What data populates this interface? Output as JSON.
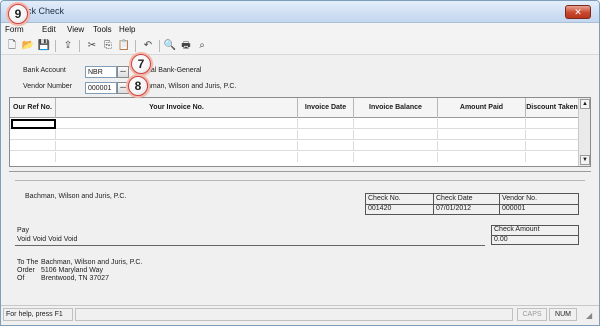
{
  "window": {
    "title": "Quick Check",
    "title_visible": "ick Check",
    "close_glyph": "✕"
  },
  "callouts": {
    "c9": "9",
    "c7": "7",
    "c8": "8"
  },
  "menu": {
    "items": [
      "Form",
      "Edit",
      "View",
      "Tools",
      "Help"
    ]
  },
  "toolbar": {
    "icons": [
      "new-document-icon",
      "open-folder-icon",
      "save-icon",
      "export-icon",
      "cut-icon",
      "copy-icon",
      "paste-icon",
      "undo-icon",
      "find-icon",
      "print-icon",
      "spellcheck-icon"
    ],
    "glyphs": [
      "🗋",
      "📂",
      "💾",
      "⇪",
      "✂",
      "⎘",
      "📋",
      "↶",
      "🔍",
      "🖶",
      "⌕"
    ]
  },
  "form": {
    "bank_account_label": "Bank Account",
    "bank_account_value": "NBR",
    "bank_account_desc": "nal Bank-General",
    "vendor_number_label": "Vendor Number",
    "vendor_number_value": "000001",
    "vendor_desc": "hman, Wilson and Juris, P.C.",
    "ellipsis": "..."
  },
  "grid": {
    "columns": [
      "Our Ref No.",
      "Your Invoice No.",
      "Invoice Date",
      "Invoice Balance",
      "Amount Paid",
      "Discount Taken"
    ],
    "scroll_up": "▲",
    "scroll_down": "▼"
  },
  "check": {
    "payee_name": "Bachman, Wilson and Juris, P.C.",
    "check_no_label": "Check No.",
    "check_no_value": "001420",
    "check_date_label": "Check Date",
    "check_date_value": "07/01/2012",
    "vendor_no_label": "Vendor No.",
    "vendor_no_value": "000001",
    "pay_label": "Pay",
    "pay_words": "Void Void Void Void",
    "check_amount_label": "Check Amount",
    "check_amount_value": "0.00",
    "to_the_label": "To The",
    "order_label": "Order",
    "of_label": "Of",
    "address_line1": "Bachman, Wilson and Juris, P.C.",
    "address_line2": "5106 Maryland Way",
    "address_line3": "Brentwood, TN 37027"
  },
  "status": {
    "help": "For help, press F1",
    "caps": "CAPS",
    "num": "NUM"
  }
}
